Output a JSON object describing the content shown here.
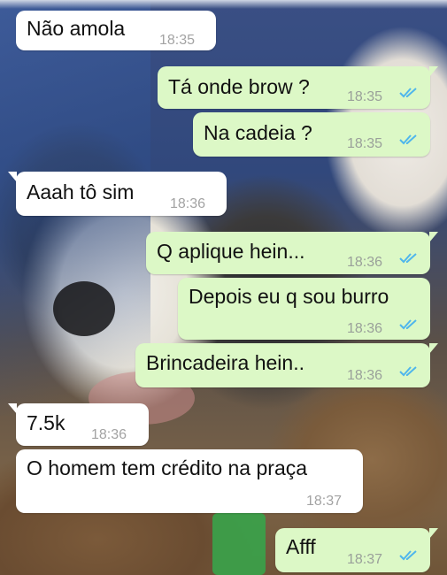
{
  "messages": [
    {
      "direction": "in",
      "text": "Não amola",
      "time": "18:35"
    },
    {
      "direction": "out",
      "text": "Tá onde brow ?",
      "time": "18:35",
      "status": "read"
    },
    {
      "direction": "out",
      "text": "Na cadeia ?",
      "time": "18:35",
      "status": "read"
    },
    {
      "direction": "in",
      "text": "Aaah tô sim",
      "time": "18:36"
    },
    {
      "direction": "out",
      "text": "Q aplique hein...",
      "time": "18:36",
      "status": "read"
    },
    {
      "direction": "out",
      "text": "Depois eu q sou burro",
      "time": "18:36",
      "status": "read"
    },
    {
      "direction": "out",
      "text": "Brincadeira hein..",
      "time": "18:36",
      "status": "read"
    },
    {
      "direction": "in",
      "text": "7.5k",
      "time": "18:36"
    },
    {
      "direction": "in",
      "text": "O homem tem crédito na praça",
      "time": "18:37"
    },
    {
      "direction": "out",
      "text": "Afff",
      "time": "18:37",
      "status": "read"
    }
  ],
  "colors": {
    "outgoing_bubble": "#dcf8c6",
    "incoming_bubble": "#ffffff",
    "read_ticks": "#4fb6ec",
    "timestamp": "#9aa09a"
  },
  "icons": {
    "read_receipt": "double-check-icon"
  }
}
